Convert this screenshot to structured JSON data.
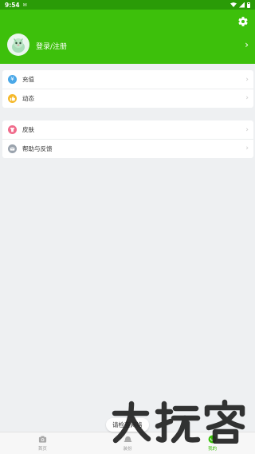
{
  "status_bar": {
    "time": "9:54",
    "notification": "✉"
  },
  "header": {
    "login_label": "登录/注册",
    "avatar_icon": "robot-avatar-icon",
    "settings_icon": "gear-icon",
    "chevron": "›"
  },
  "menu_group_1": [
    {
      "label": "充值",
      "icon": "recharge-icon",
      "color": "#4aa8e8",
      "chevron": "›"
    },
    {
      "label": "动态",
      "icon": "thumbs-up-icon",
      "color": "#f5b92b",
      "chevron": "›"
    }
  ],
  "menu_group_2": [
    {
      "label": "皮肤",
      "icon": "shirt-icon",
      "color": "#f06c8c",
      "chevron": "›"
    },
    {
      "label": "帮助与反馈",
      "icon": "mail-icon",
      "color": "#9aa3ad",
      "chevron": "›"
    }
  ],
  "toast": {
    "text": "请检查网络"
  },
  "bottom_nav": [
    {
      "label": "首页",
      "icon": "camera-icon",
      "active": false
    },
    {
      "label": "装扮",
      "icon": "hat-icon",
      "active": false
    },
    {
      "label": "我的",
      "icon": "profile-icon",
      "active": true
    }
  ],
  "colors": {
    "accent": "#3dc00b",
    "status_bar": "#2a9b07",
    "background": "#eef0f2"
  }
}
